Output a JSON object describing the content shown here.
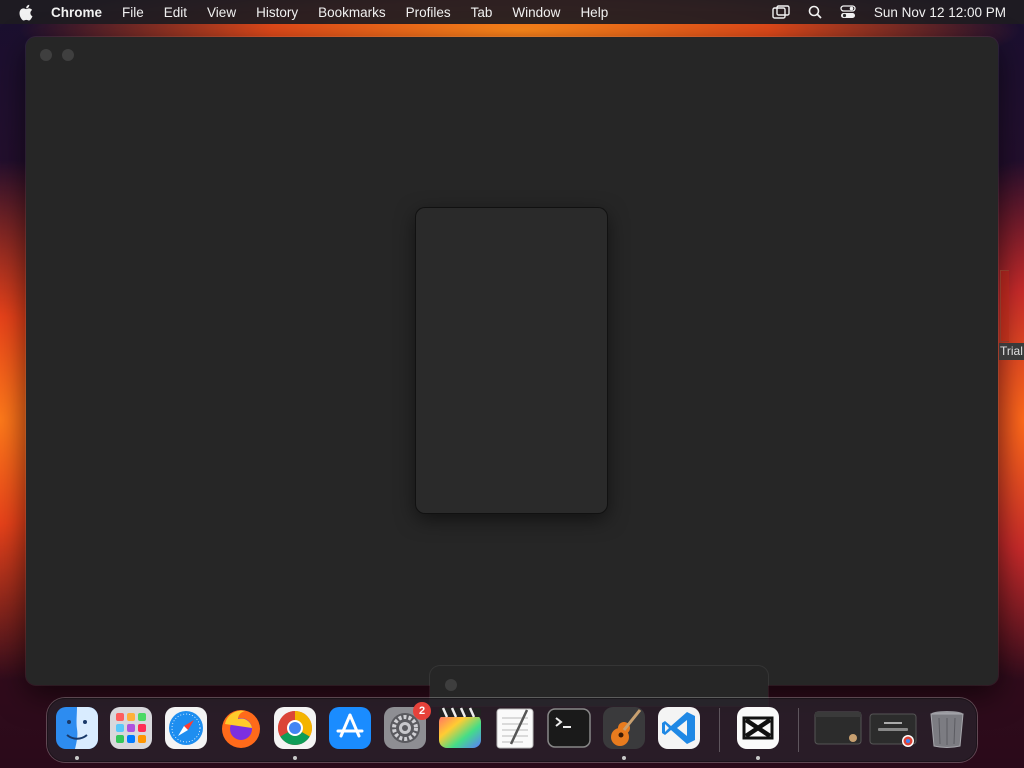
{
  "menubar": {
    "app_name": "Chrome",
    "items": [
      "File",
      "Edit",
      "View",
      "History",
      "Bookmarks",
      "Profiles",
      "Tab",
      "Window",
      "Help"
    ],
    "clock": "Sun Nov 12  12:00 PM"
  },
  "edge_window": {
    "label": "Trial"
  },
  "dock": {
    "apps": [
      {
        "name": "Finder",
        "icon": "finder-icon",
        "running": true
      },
      {
        "name": "Launchpad",
        "icon": "launchpad-icon",
        "running": false
      },
      {
        "name": "Safari",
        "icon": "safari-icon",
        "running": false
      },
      {
        "name": "Firefox",
        "icon": "firefox-icon",
        "running": false
      },
      {
        "name": "Chrome",
        "icon": "chrome-icon",
        "running": true
      },
      {
        "name": "App Store",
        "icon": "app-store-icon",
        "running": false
      },
      {
        "name": "System Settings",
        "icon": "system-settings-icon",
        "running": false,
        "badge": "2"
      },
      {
        "name": "Final Cut Pro",
        "icon": "final-cut-icon",
        "running": false
      },
      {
        "name": "TextEdit",
        "icon": "textedit-icon",
        "running": false
      },
      {
        "name": "Terminal",
        "icon": "terminal-icon",
        "running": false
      },
      {
        "name": "GarageBand",
        "icon": "garageband-icon",
        "running": true
      },
      {
        "name": "Visual Studio Code",
        "icon": "vscode-icon",
        "running": false
      },
      {
        "name": "CapCut",
        "icon": "capcut-icon",
        "running": true
      }
    ],
    "recent": [
      "minimized-window-icon",
      "chrome-window-thumbnail-icon",
      "trash-icon"
    ]
  },
  "colors": {
    "window_bg": "#262626",
    "accent": "#e6413a"
  }
}
